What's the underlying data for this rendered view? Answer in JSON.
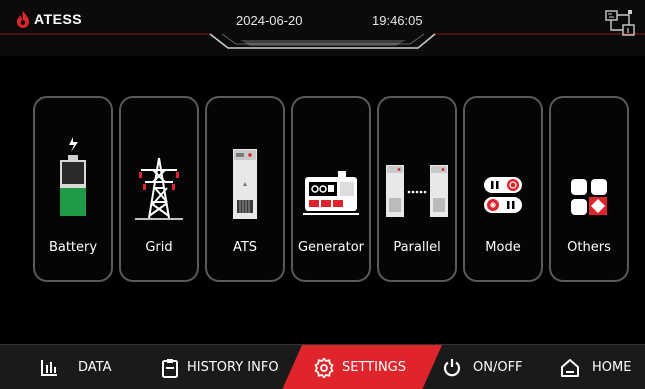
{
  "header": {
    "logo_text": "ATESS",
    "date": "2024-06-20",
    "time": "19:46:05"
  },
  "tiles": [
    {
      "label": "Battery"
    },
    {
      "label": "Grid"
    },
    {
      "label": "ATS"
    },
    {
      "label": "Generator"
    },
    {
      "label": "Parallel"
    },
    {
      "label": "Mode"
    },
    {
      "label": "Others"
    }
  ],
  "nav": {
    "data": "DATA",
    "history": "HISTORY INFO",
    "settings": "SETTINGS",
    "onoff": "ON/OFF",
    "home": "HOME",
    "active": "settings"
  },
  "colors": {
    "accent_red": "#e0242c",
    "battery_green": "#1f9a46",
    "tile_border": "#5a5a5a"
  },
  "icons": {
    "battery": "battery-icon",
    "grid": "transmission-tower-icon",
    "ats": "ats-cabinet-icon",
    "generator": "generator-icon",
    "parallel": "parallel-cabinets-icon",
    "mode": "mode-toggle-icon",
    "others": "others-grid-icon"
  }
}
